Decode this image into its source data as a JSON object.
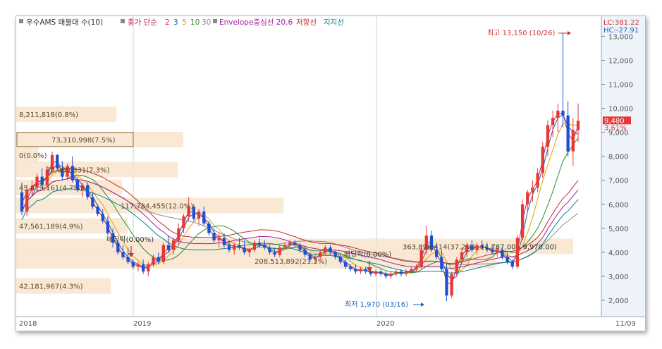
{
  "legend": {
    "title": "우수AMS 매물대 수(10)",
    "ma_label": "종가 단순",
    "ma_periods": [
      {
        "label": "2",
        "color": "#d81b60"
      },
      {
        "label": "3",
        "color": "#1565c0"
      },
      {
        "label": "5",
        "color": "#e6a000"
      },
      {
        "label": "10",
        "color": "#2e8b2e"
      },
      {
        "label": "30",
        "color": "#8e8e8e"
      }
    ],
    "envelope": "Envelope중심선 20,6",
    "resistance": "저항선",
    "support": "지지선",
    "envelope_color": "#a020a0",
    "resistance_color": "#c62828",
    "support_color": "#00838f"
  },
  "corner": {
    "lc": "LC:381.22",
    "hc": "HC:-27.91"
  },
  "current": {
    "price": "9,480",
    "change": "3.61%",
    "color": "#e53935"
  },
  "annotations": {
    "high": "최고 13,150 (10/26)",
    "low": "최저 1,970 (03/16)",
    "div1": "배당락(0.00%)",
    "div2": "배당락(0.00%)"
  },
  "volume_profile": [
    {
      "label": "8,211,818(0.8%)",
      "price": 9750,
      "len_frac": 0.18,
      "boxed": false
    },
    {
      "label": "73,310,998(7.5%)",
      "price": 8700,
      "len_frac": 0.3,
      "boxed": true
    },
    {
      "label": "0(0.0%)",
      "price": 8050,
      "len_frac": 0.04,
      "boxed": false
    },
    {
      "label": "70,900,831(7.3%)",
      "price": 7450,
      "len_frac": 0.29,
      "boxed": false
    },
    {
      "label": "45,819,161(4.7%)",
      "price": 6700,
      "len_frac": 0.19,
      "boxed": false
    },
    {
      "label": "117,784,455(12.0%)",
      "price": 5950,
      "len_frac": 0.48,
      "boxed": false
    },
    {
      "label": "47,561,189(4.9%)",
      "price": 5100,
      "len_frac": 0.2,
      "boxed": false
    },
    {
      "label": "208,513,892(21.3%)",
      "price": 3650,
      "len_frac": 0.86,
      "boxed": false
    },
    {
      "label": "363,896,414(37.2%)",
      "price": 4250,
      "len_frac": 1.0,
      "boxed": false
    },
    {
      "label": "42,181,967(4.3%)",
      "price": 2600,
      "len_frac": 0.17,
      "boxed": false
    }
  ],
  "vp_extra_label": "(4,787.00 - 9,970.00)",
  "x_labels": [
    "2018",
    "2019",
    "2020",
    "11/09"
  ],
  "chart_data": {
    "type": "candlestick",
    "y_axis_ticks": [
      "2,000",
      "3,000",
      "4,000",
      "5,000",
      "6,000",
      "7,000",
      "8,000",
      "9,000",
      "10,000",
      "11,000",
      "12,000",
      "13,000"
    ],
    "ylim": [
      1500,
      13600
    ],
    "high": 13150,
    "low": 1970,
    "last": 9480,
    "candles": [
      [
        6500,
        6900,
        5550,
        5700
      ],
      [
        5700,
        6800,
        5500,
        6600
      ],
      [
        6600,
        7000,
        6300,
        6700
      ],
      [
        6700,
        7300,
        6500,
        7150
      ],
      [
        7150,
        7500,
        6700,
        6800
      ],
      [
        6800,
        7600,
        6600,
        7450
      ],
      [
        7450,
        8200,
        7300,
        8050
      ],
      [
        8050,
        8100,
        7400,
        7500
      ],
      [
        7500,
        7800,
        7000,
        7150
      ],
      [
        7150,
        7700,
        7000,
        7600
      ],
      [
        7600,
        8000,
        6900,
        7000
      ],
      [
        7000,
        7100,
        6500,
        6600
      ],
      [
        6600,
        6900,
        6300,
        6800
      ],
      [
        6800,
        6900,
        6200,
        6300
      ],
      [
        6300,
        6500,
        5800,
        5900
      ],
      [
        5900,
        6000,
        5500,
        5600
      ],
      [
        5600,
        5800,
        5200,
        5300
      ],
      [
        5300,
        5500,
        4700,
        4800
      ],
      [
        4800,
        5000,
        4200,
        4400
      ],
      [
        4400,
        4500,
        3900,
        4000
      ],
      [
        4000,
        4300,
        3700,
        3800
      ],
      [
        3800,
        4200,
        3500,
        3600
      ],
      [
        3600,
        3700,
        3300,
        3400
      ],
      [
        3400,
        3600,
        3200,
        3500
      ],
      [
        3500,
        3700,
        3100,
        3200
      ],
      [
        3200,
        3600,
        3000,
        3500
      ],
      [
        3500,
        3900,
        3400,
        3800
      ],
      [
        3800,
        4000,
        3500,
        3600
      ],
      [
        3600,
        4400,
        3500,
        4300
      ],
      [
        4300,
        4700,
        4000,
        4100
      ],
      [
        4100,
        4600,
        3900,
        4500
      ],
      [
        4500,
        5200,
        4300,
        5000
      ],
      [
        5000,
        5600,
        4800,
        5500
      ],
      [
        5500,
        6300,
        5300,
        5900
      ],
      [
        5900,
        6000,
        5300,
        5400
      ],
      [
        5400,
        5800,
        5100,
        5700
      ],
      [
        5700,
        5900,
        5100,
        5200
      ],
      [
        5200,
        5300,
        4700,
        4800
      ],
      [
        4800,
        5000,
        4400,
        4500
      ],
      [
        4500,
        4800,
        4200,
        4600
      ],
      [
        4600,
        4800,
        4200,
        4300
      ],
      [
        4300,
        4500,
        4000,
        4100
      ],
      [
        4100,
        4400,
        3900,
        4300
      ],
      [
        4300,
        4600,
        4100,
        4200
      ],
      [
        4200,
        4500,
        3900,
        4000
      ],
      [
        4000,
        4200,
        3800,
        4100
      ],
      [
        4100,
        4500,
        4000,
        4400
      ],
      [
        4400,
        4600,
        4200,
        4300
      ],
      [
        4300,
        4500,
        4100,
        4200
      ],
      [
        4200,
        4300,
        3900,
        4000
      ],
      [
        4000,
        4200,
        3800,
        3900
      ],
      [
        3900,
        4300,
        3800,
        4200
      ],
      [
        4200,
        4400,
        4100,
        4300
      ],
      [
        4300,
        4500,
        4200,
        4400
      ],
      [
        4400,
        4500,
        4200,
        4300
      ],
      [
        4300,
        4400,
        4000,
        4100
      ],
      [
        4100,
        4200,
        3800,
        3900
      ],
      [
        3900,
        4000,
        3600,
        3700
      ],
      [
        3700,
        3900,
        3500,
        3800
      ],
      [
        3800,
        4100,
        3700,
        4000
      ],
      [
        4000,
        4300,
        3900,
        4200
      ],
      [
        4200,
        4300,
        3900,
        4000
      ],
      [
        4000,
        4100,
        3700,
        3800
      ],
      [
        3800,
        3900,
        3500,
        3600
      ],
      [
        3600,
        3700,
        3300,
        3400
      ],
      [
        3400,
        3500,
        3200,
        3300
      ],
      [
        3300,
        3500,
        3100,
        3200
      ],
      [
        3200,
        3400,
        3100,
        3300
      ],
      [
        3300,
        3400,
        3100,
        3200
      ],
      [
        3200,
        3300,
        3000,
        3100
      ],
      [
        3100,
        3300,
        3000,
        3200
      ],
      [
        3200,
        3300,
        3000,
        3100
      ],
      [
        3100,
        3200,
        2900,
        3000
      ],
      [
        3000,
        3200,
        2900,
        3100
      ],
      [
        3100,
        3300,
        3000,
        3200
      ],
      [
        3200,
        3300,
        3000,
        3100
      ],
      [
        3100,
        3300,
        3000,
        3200
      ],
      [
        3200,
        3400,
        3100,
        3300
      ],
      [
        3300,
        3500,
        3200,
        3400
      ],
      [
        3400,
        4300,
        3300,
        4100
      ],
      [
        4100,
        5100,
        3900,
        4700
      ],
      [
        4700,
        4900,
        4000,
        4100
      ],
      [
        4100,
        4400,
        3700,
        3800
      ],
      [
        3800,
        4100,
        3200,
        3300
      ],
      [
        3300,
        3500,
        1970,
        2200
      ],
      [
        2200,
        3200,
        2100,
        3100
      ],
      [
        3100,
        3800,
        3000,
        3700
      ],
      [
        3700,
        4200,
        3500,
        4000
      ],
      [
        4000,
        4400,
        3800,
        4300
      ],
      [
        4300,
        4500,
        4000,
        4100
      ],
      [
        4100,
        4400,
        3900,
        4300
      ],
      [
        4300,
        4500,
        4100,
        4200
      ],
      [
        4200,
        4400,
        4000,
        4100
      ],
      [
        4100,
        4300,
        3900,
        4000
      ],
      [
        4000,
        4200,
        3800,
        4100
      ],
      [
        4100,
        4200,
        3700,
        3800
      ],
      [
        3800,
        4000,
        3500,
        3600
      ],
      [
        3600,
        3700,
        3300,
        3400
      ],
      [
        3400,
        4700,
        3300,
        4600
      ],
      [
        4600,
        6200,
        4500,
        6000
      ],
      [
        6000,
        6600,
        5700,
        6500
      ],
      [
        6500,
        7000,
        6100,
        6700
      ],
      [
        6700,
        7500,
        6500,
        7300
      ],
      [
        7300,
        8600,
        7100,
        8400
      ],
      [
        8400,
        9500,
        8000,
        9300
      ],
      [
        9300,
        9900,
        8800,
        9600
      ],
      [
        9600,
        10200,
        9000,
        9900
      ],
      [
        9900,
        13150,
        9200,
        9700
      ],
      [
        9700,
        10300,
        8000,
        8200
      ],
      [
        8200,
        9600,
        7600,
        9100
      ],
      [
        9100,
        10200,
        8600,
        9480
      ]
    ]
  }
}
